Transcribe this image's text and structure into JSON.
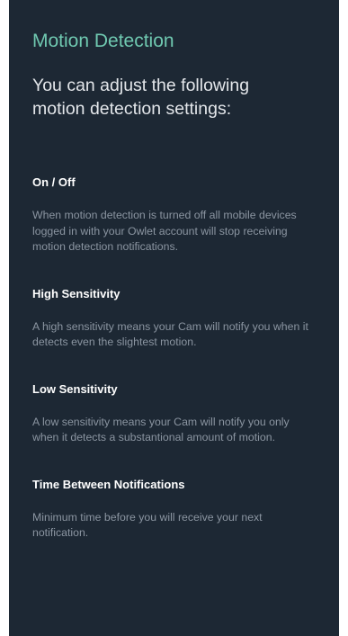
{
  "header": {
    "title": "Motion Detection",
    "subtitle": "You can adjust the following motion detection settings:"
  },
  "sections": [
    {
      "heading": "On / Off",
      "body": "When motion detection is turned off all mobile devices logged in with your Owlet account will stop receiving motion detection notifications."
    },
    {
      "heading": "High Sensitivity",
      "body": "A high sensitivity means your Cam will notify you when it detects even the slightest motion."
    },
    {
      "heading": "Low Sensitivity",
      "body": "A low sensitivity means your Cam will notify you only when it detects a substantional amount of motion."
    },
    {
      "heading": "Time Between Notifications",
      "body": "Minimum time before you will receive your next notification."
    }
  ],
  "colors": {
    "background": "#1d2834",
    "accent": "#6fc8b0",
    "heading": "#ffffff",
    "body": "#8b95a1"
  }
}
